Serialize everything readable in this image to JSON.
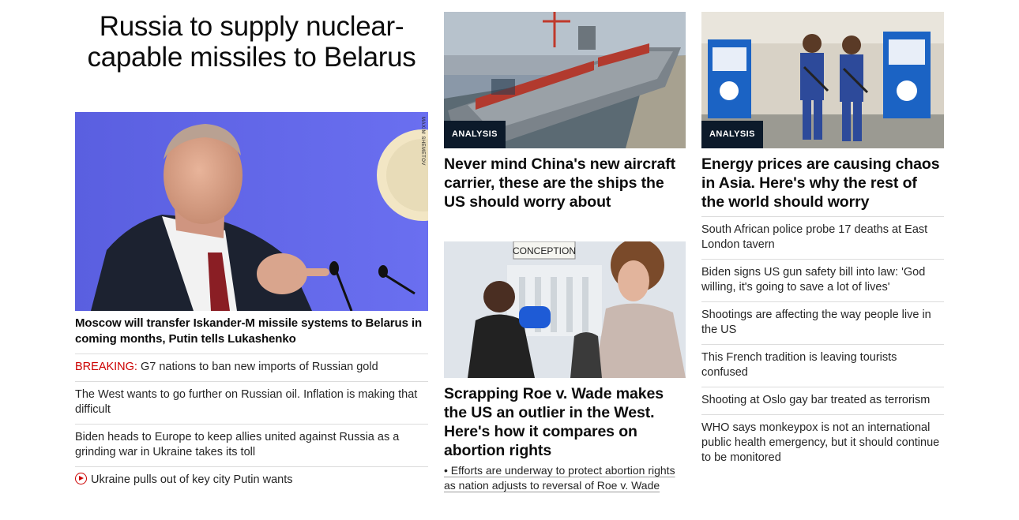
{
  "lead": {
    "headline": "Russia to supply nuclear-capable missiles to Belarus",
    "image_credit": "Maxim Shemetov",
    "sub_headline": "Moscow will transfer Iskander-M missile systems to Belarus in coming months, Putin tells Lukashenko",
    "links": [
      {
        "label": "BREAKING:",
        "text": "G7 nations to ban new imports of Russian gold"
      },
      {
        "text": "The West wants to go further on Russian oil. Inflation is making that difficult"
      },
      {
        "text": "Biden heads to Europe to keep allies united against Russia as a grinding war in Ukraine takes its toll"
      },
      {
        "icon": "play-icon",
        "text": "Ukraine pulls out of key city Putin wants"
      }
    ]
  },
  "middle": {
    "card1": {
      "badge": "Analysis",
      "title": "Never mind China's new aircraft carrier, these are the ships the US should worry about"
    },
    "card2": {
      "sign_text": "CONCEPTION",
      "title": "Scrapping Roe v. Wade makes the US an outlier in the West. Here's how it compares on abortion rights",
      "related": "• Efforts are underway to protect abortion rights as nation adjusts to reversal of Roe v. Wade"
    }
  },
  "right": {
    "card": {
      "badge": "Analysis",
      "title": "Energy prices are causing chaos in Asia. Here's why the rest of the world should worry"
    },
    "links": [
      "South African police probe 17 deaths at East London tavern",
      "Biden signs US gun safety bill into law: 'God willing, it's going to save a lot of lives'",
      "Shootings are affecting the way people live in the US",
      "This French tradition is leaving tourists confused",
      "Shooting at Oslo gay bar treated as terrorism",
      "WHO says monkeypox is not an international public health emergency, but it should continue to be monitored"
    ]
  },
  "colors": {
    "breaking": "#cc0000",
    "badge_bg": "#0c1a2a",
    "divider": "#dcdcdc"
  }
}
